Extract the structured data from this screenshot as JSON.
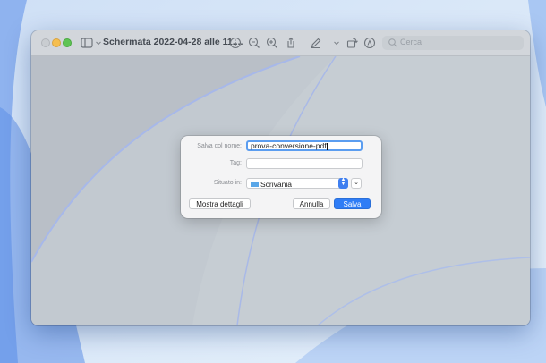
{
  "window": {
    "title": "Schermata 2022-04-28 alle 11....",
    "search_placeholder": "Cerca"
  },
  "dialog": {
    "save_as_label": "Salva col nome:",
    "save_as_value": "prova-conversione-pdf",
    "tags_label": "Tag:",
    "tags_value": "",
    "location_label": "Situato in:",
    "location_value": "Scrivania",
    "details_button": "Mostra dettagli",
    "cancel_button": "Annulla",
    "save_button": "Salva"
  },
  "colors": {
    "accent": "#2f7df6",
    "focus_ring": "#5b9df0"
  }
}
